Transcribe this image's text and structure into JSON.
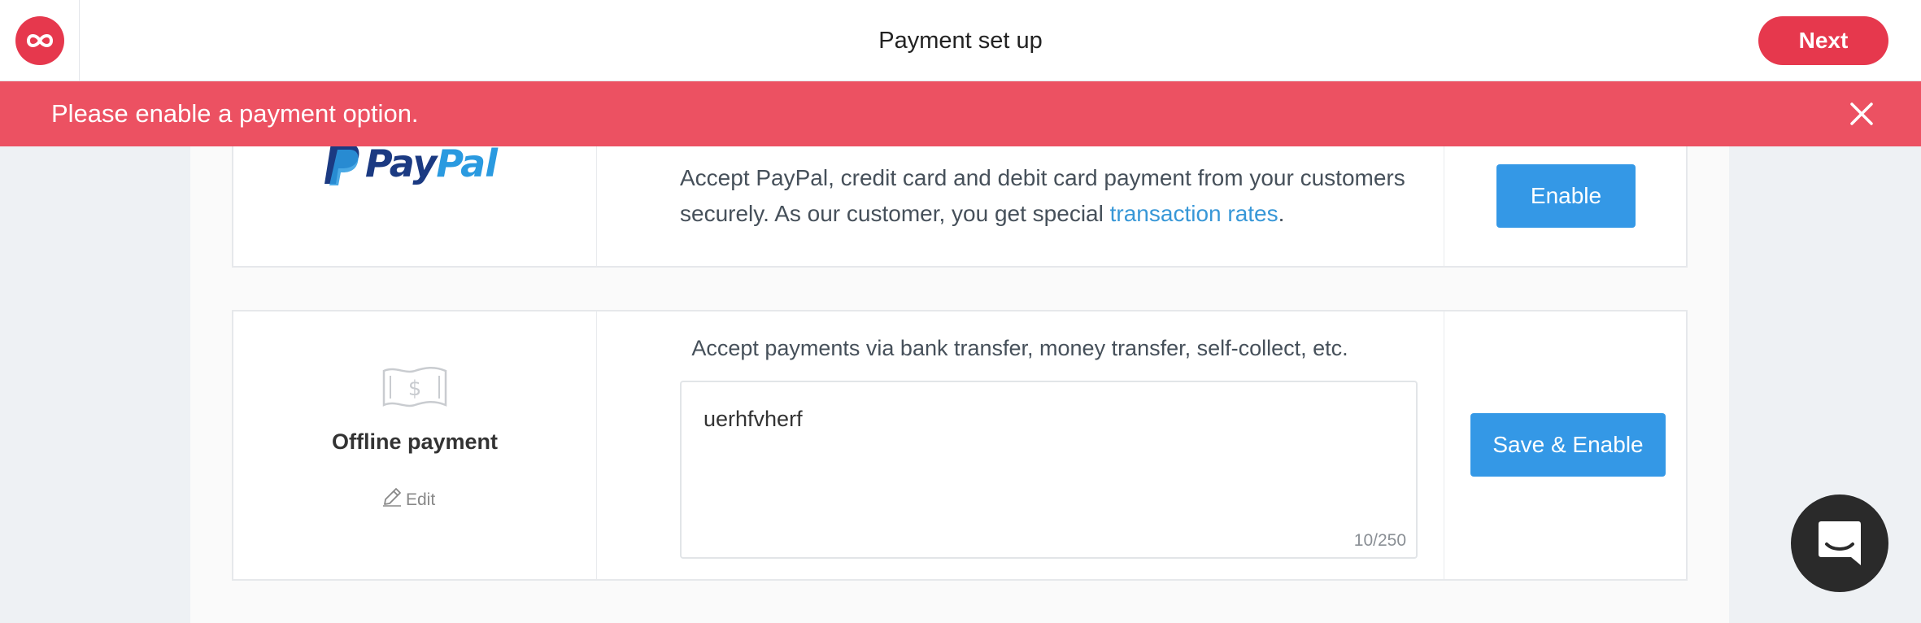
{
  "header": {
    "title": "Payment set up",
    "next_label": "Next",
    "logo_icon": "infinity-icon"
  },
  "alert": {
    "message": "Please enable a payment option.",
    "close_icon": "close-icon"
  },
  "paypal": {
    "logo_text_pay": "Pay",
    "logo_text_pal": "Pal",
    "description_start": "Accept PayPal, credit card and debit card payment from your customers securely. As our customer, you get special ",
    "link_text": "transaction rates",
    "description_end": ".",
    "enable_label": "Enable"
  },
  "offline": {
    "icon": "banknote-icon",
    "title": "Offline payment",
    "edit_label": "Edit",
    "description": "Accept payments via bank transfer, money transfer, self-collect, etc.",
    "instructions_value": "uerhfvherf",
    "char_count": "10/250",
    "save_label": "Save & Enable"
  },
  "chat": {
    "icon": "chat-icon"
  },
  "colors": {
    "brand_red": "#e6384d",
    "alert_red": "#ec5162",
    "action_blue": "#3498e6",
    "link_blue": "#3797d7"
  }
}
